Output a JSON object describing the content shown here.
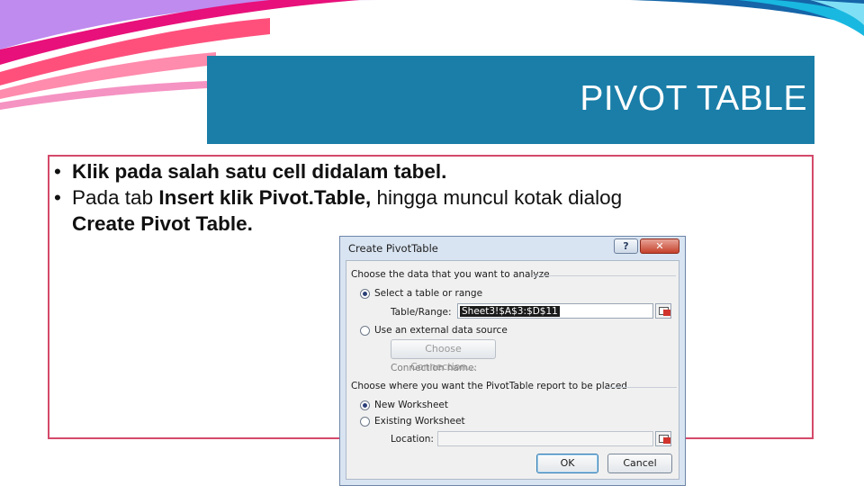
{
  "slide": {
    "title": "PIVOT TABLE",
    "bullets": [
      {
        "b1": "Klik pada salah satu cell didalam tabel."
      },
      {
        "t1": "Pada tab ",
        "b1": "Insert klik Pivot.Table,",
        "t2": " hingga muncul kotak dialog ",
        "b2": "Create Pivot Table."
      }
    ],
    "bullet_char": "•"
  },
  "dialog": {
    "title": "Create PivotTable",
    "help_label": "?",
    "close_label": "✕",
    "section1_label": "Choose the data that you want to analyze",
    "radio_select_table": "Select a table or range",
    "table_range_label": "Table/Range:",
    "table_range_value": "Sheet3!$A$3:$D$11",
    "radio_external": "Use an external data source",
    "choose_connection_label": "Choose Connection...",
    "connection_name_label": "Connection name:",
    "section2_label": "Choose where you want the PivotTable report to be placed",
    "radio_new_worksheet": "New Worksheet",
    "radio_existing_worksheet": "Existing Worksheet",
    "location_label": "Location:",
    "location_value": "",
    "ok_label": "OK",
    "cancel_label": "Cancel"
  },
  "colors": {
    "title_band": "#1a7ea8",
    "content_border": "#d4496a",
    "decor_pink": "#e8107a",
    "decor_cyan": "#19b8e0"
  }
}
